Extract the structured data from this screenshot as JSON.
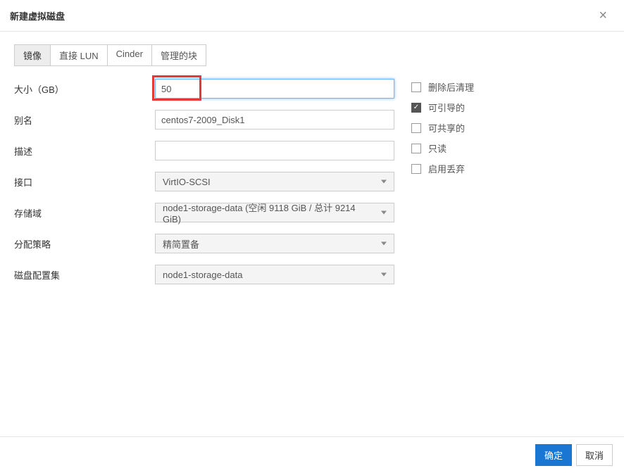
{
  "dialog": {
    "title": "新建虚拟磁盘",
    "close_icon": "×"
  },
  "tabs": [
    {
      "label": "镜像",
      "active": true
    },
    {
      "label": "直接 LUN",
      "active": false
    },
    {
      "label": "Cinder",
      "active": false
    },
    {
      "label": "管理的块",
      "active": false
    }
  ],
  "form": {
    "size": {
      "label": "大小（GB）",
      "value": "50"
    },
    "alias": {
      "label": "别名",
      "value": "centos7-2009_Disk1"
    },
    "description": {
      "label": "描述",
      "value": ""
    },
    "interface": {
      "label": "接口",
      "value": "VirtIO-SCSI"
    },
    "storage_domain": {
      "label": "存储域",
      "value": "node1-storage-data (空闲 9118 GiB / 总计 9214 GiB)"
    },
    "allocation_policy": {
      "label": "分配策略",
      "value": "精简置备"
    },
    "disk_profile": {
      "label": "磁盘配置集",
      "value": "node1-storage-data"
    }
  },
  "options": {
    "wipe_after_delete": {
      "label": "删除后清理",
      "checked": false
    },
    "bootable": {
      "label": "可引导的",
      "checked": true
    },
    "shareable": {
      "label": "可共享的",
      "checked": false
    },
    "read_only": {
      "label": "只读",
      "checked": false
    },
    "enable_discard": {
      "label": "启用丢弃",
      "checked": false
    }
  },
  "footer": {
    "ok": "确定",
    "cancel": "取消"
  }
}
